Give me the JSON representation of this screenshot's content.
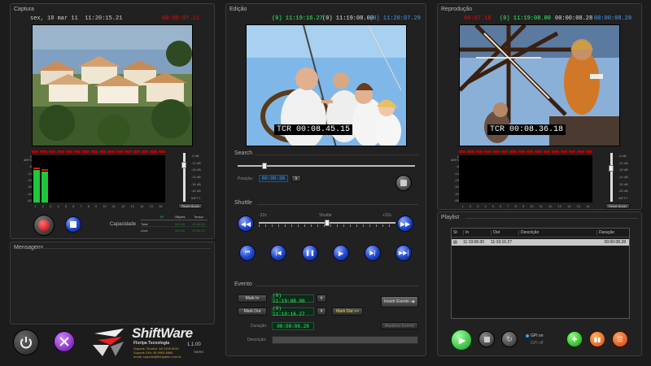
{
  "captura": {
    "title": "Captura",
    "date": "sex, 18 mar 11",
    "time": "11:20:15.21",
    "tc_red": "00:00:07.11",
    "db_scale": [
      "0 dBFS",
      "-6",
      "-12",
      "-20",
      "-30",
      "-40",
      "-60"
    ],
    "channels": [
      "1",
      "2",
      "3",
      "4",
      "5",
      "6",
      "7",
      "8",
      "9",
      "10",
      "11",
      "12",
      "13",
      "14",
      "15",
      "16"
    ],
    "fader_scale": [
      "-6 dB",
      "-12 dB",
      "-18 dB",
      "-24 dB",
      "-30 dB",
      "-40 dB",
      "INFTY"
    ],
    "fader_button": "Reset Áudio",
    "capacidade_label": "Capacidade",
    "cap_headers": [
      "Nº",
      "GBytes",
      "Tempo"
    ],
    "cap_rows": [
      {
        "label": "Total",
        "gb": "000,00",
        "tempo": "00:00:00"
      },
      {
        "label": "Livre",
        "gb": "000,00",
        "tempo": "00:00:00"
      }
    ]
  },
  "mensagens": {
    "title": "Mensagens"
  },
  "edicao": {
    "title": "Edição",
    "tc_in": "(0) 11:19:16.27",
    "tc_mid": "(0) 11:19:08.00",
    "tc_out": "(0) 11:20:07.29",
    "tcr": "TCR 00:08.45.15"
  },
  "search": {
    "title": "Search",
    "pos_label": "Posição:",
    "pos_value": "00:00:00",
    "go_label": "Ir"
  },
  "shuttle": {
    "title": "Shuttle",
    "min": "-32x",
    "label": "Shuttle",
    "max": "+32x"
  },
  "evento": {
    "title": "Evento",
    "mark_in": "Mark In",
    "mark_in_value": "(0) 11:19:08.00",
    "mark_out": "Mark Out",
    "mark_out_value": "(0) 11:19:16.27",
    "mark_out_go": "Mark Out >>",
    "go_small": "Ir",
    "inserir": "Inserir Evento",
    "duracao_label": "Duração:",
    "duracao_value": "00:00:08.28",
    "descricao_label": "Descrição:",
    "disabled_btn": "Atualizar Evento"
  },
  "reproducao": {
    "title": "Reprodução",
    "tc_red": "00:07.18",
    "tc_mid": "(0) 11:19:08.00",
    "tc_dur": "00:00:08.28",
    "tc_blue": "00:00:08.28",
    "tcr": "TCR 00:08.36.18",
    "fader_button": "Reset Áudio"
  },
  "playlist": {
    "title": "Playlist",
    "headers": [
      "St",
      "In",
      "Out",
      "Descrição",
      "Duração"
    ],
    "rows": [
      {
        "in": "11:19:08.00",
        "out": "11:19:16.27",
        "desc": "",
        "dur": "00:00:08.28"
      }
    ],
    "gpi_on": "GPI on",
    "gpi_off": "GPI off"
  },
  "branding": {
    "name": "ShiftWare",
    "company": "Floripa Tecnologia",
    "version": "1.1.00",
    "edition": "SWRS",
    "support1": "Suporte Técnico: 48 3108.9010",
    "support2": "Suporte 24h: 48 9963.6865",
    "email": "email: suporte@floripatec.com.br"
  },
  "colors": {
    "green_tc": "#2eff5a",
    "blue_tc": "#3ea0ff",
    "red_tc": "#e01010",
    "accent_blue": "#1e46c8"
  }
}
